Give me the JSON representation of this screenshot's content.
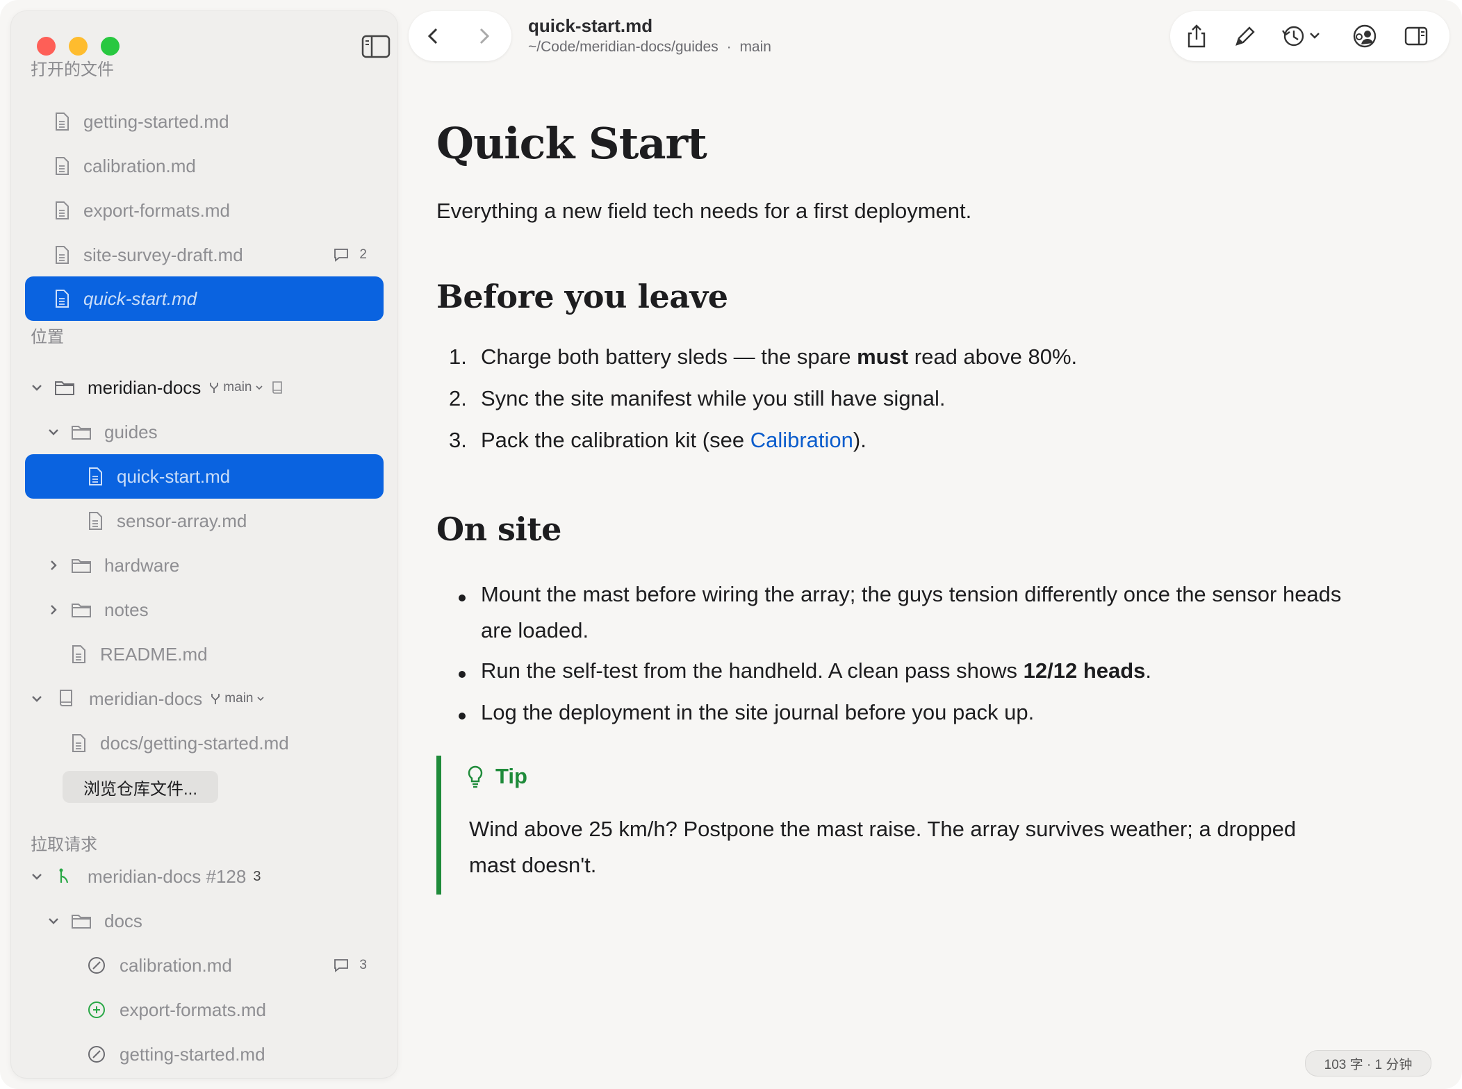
{
  "window": {
    "title": "quick-start.md",
    "path": "~/Code/meridian-docs/guides",
    "branch": "main",
    "separator": "·"
  },
  "sidebar": {
    "open_files_header": "打开的文件",
    "open_files": [
      {
        "label": "getting-started.md"
      },
      {
        "label": "calibration.md"
      },
      {
        "label": "export-formats.md"
      },
      {
        "label": "site-survey-draft.md",
        "comments": "2"
      },
      {
        "label": "quick-start.md",
        "selected": true
      }
    ],
    "locations_header": "位置",
    "repo1": {
      "label": "meridian-docs",
      "branch": "main"
    },
    "guides_folder": "guides",
    "guides_files": [
      "quick-start.md",
      "sensor-array.md"
    ],
    "hardware_folder": "hardware",
    "notes_folder": "notes",
    "readme": "README.md",
    "repo2": {
      "label": "meridian-docs",
      "branch": "main"
    },
    "repo2_file": "docs/getting-started.md",
    "browse_button": "浏览仓库文件...",
    "pull_requests_header": "拉取请求",
    "pr": {
      "label": "meridian-docs #128",
      "count": "3"
    },
    "pr_folder": "docs",
    "pr_files": [
      {
        "label": "calibration.md",
        "status": "modified",
        "comments": "3"
      },
      {
        "label": "export-formats.md",
        "status": "added"
      },
      {
        "label": "getting-started.md",
        "status": "modified"
      }
    ]
  },
  "doc": {
    "h1": "Quick Start",
    "lead": "Everything a new field tech needs for a first deployment.",
    "h2_before": "Before you leave",
    "ol": [
      {
        "num": "1.",
        "pre": "Charge both battery sleds — the spare ",
        "bold": "must",
        "post": " read above 80%."
      },
      {
        "num": "2.",
        "text": "Sync the site manifest while you still have signal."
      },
      {
        "num": "3.",
        "pre": "Pack the calibration kit (see ",
        "link": "Calibration",
        "post": ")."
      }
    ],
    "h2_onsite": "On site",
    "ul": [
      {
        "text": "Mount the mast before wiring the array; the guys tension differently once the sensor heads are loaded."
      },
      {
        "pre": "Run the self-test from the handheld. A clean pass shows ",
        "bold": "12/12 heads",
        "post": "."
      },
      {
        "text": "Log the deployment in the site journal before you pack up."
      }
    ],
    "tip_title": "Tip",
    "tip_body": "Wind above 25 km/h? Postpone the mast raise. The array survives weather; a dropped mast doesn't."
  },
  "status": {
    "text": "103 字 · 1 分钟"
  },
  "colors": {
    "accent": "#0a63e0",
    "tip": "#1f8b3a",
    "link": "#0a5ccc",
    "added": "#28a745"
  },
  "icons": [
    "sidebar-toggle-icon",
    "back-icon",
    "forward-icon",
    "share-icon",
    "pencil-icon",
    "history-icon",
    "collaborators-icon",
    "inspector-icon",
    "document-icon",
    "folder-icon",
    "branch-icon",
    "book-icon",
    "comment-icon",
    "pull-request-icon",
    "lightbulb-icon"
  ]
}
